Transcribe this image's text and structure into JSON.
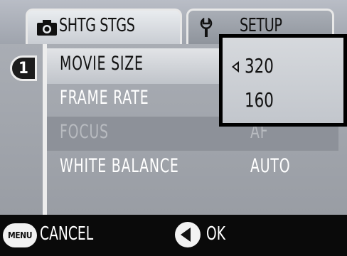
{
  "tabs": [
    {
      "label": "SHTG STGS",
      "icon": "camera-icon",
      "active": true
    },
    {
      "label": "SETUP",
      "icon": "wrench-icon",
      "active": false
    }
  ],
  "page_number": "1",
  "menu_items": [
    {
      "label": "MOVIE SIZE",
      "value": "",
      "state": "selected"
    },
    {
      "label": "FRAME RATE",
      "value": "",
      "state": "normal"
    },
    {
      "label": "FOCUS",
      "value": "AF",
      "state": "disabled"
    },
    {
      "label": "WHITE BALANCE",
      "value": "AUTO",
      "state": "normal"
    }
  ],
  "dropdown": {
    "options": [
      "320",
      "160"
    ],
    "selected": "320"
  },
  "footer": {
    "menu_badge": "MENU",
    "cancel_label": "CANCEL",
    "ok_label": "OK"
  },
  "colors": {
    "panel": "#a9adb4",
    "selected_row": "#d8dadd",
    "disabled_row": "#8d9199",
    "border": "#000000",
    "footer": "#0a0a0a"
  }
}
